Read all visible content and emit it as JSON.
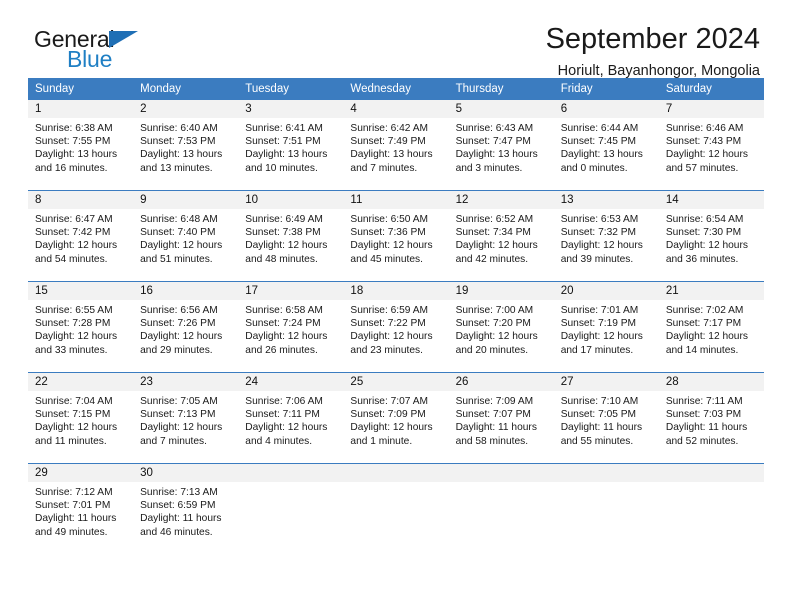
{
  "brand": {
    "word1": "General",
    "word2": "Blue",
    "logo_icon": "triangle-icon",
    "accent_color": "#1f6fb5"
  },
  "header": {
    "title": "September 2024",
    "subtitle": "Horiult, Bayanhongor, Mongolia",
    "header_bg_color": "#3b7cc0",
    "day_band_color": "#f2f2f2"
  },
  "weekday_headers": [
    "Sunday",
    "Monday",
    "Tuesday",
    "Wednesday",
    "Thursday",
    "Friday",
    "Saturday"
  ],
  "weeks": [
    [
      {
        "day": "1",
        "sunrise": "Sunrise: 6:38 AM",
        "sunset": "Sunset: 7:55 PM",
        "daylight1": "Daylight: 13 hours",
        "daylight2": "and 16 minutes."
      },
      {
        "day": "2",
        "sunrise": "Sunrise: 6:40 AM",
        "sunset": "Sunset: 7:53 PM",
        "daylight1": "Daylight: 13 hours",
        "daylight2": "and 13 minutes."
      },
      {
        "day": "3",
        "sunrise": "Sunrise: 6:41 AM",
        "sunset": "Sunset: 7:51 PM",
        "daylight1": "Daylight: 13 hours",
        "daylight2": "and 10 minutes."
      },
      {
        "day": "4",
        "sunrise": "Sunrise: 6:42 AM",
        "sunset": "Sunset: 7:49 PM",
        "daylight1": "Daylight: 13 hours",
        "daylight2": "and 7 minutes."
      },
      {
        "day": "5",
        "sunrise": "Sunrise: 6:43 AM",
        "sunset": "Sunset: 7:47 PM",
        "daylight1": "Daylight: 13 hours",
        "daylight2": "and 3 minutes."
      },
      {
        "day": "6",
        "sunrise": "Sunrise: 6:44 AM",
        "sunset": "Sunset: 7:45 PM",
        "daylight1": "Daylight: 13 hours",
        "daylight2": "and 0 minutes."
      },
      {
        "day": "7",
        "sunrise": "Sunrise: 6:46 AM",
        "sunset": "Sunset: 7:43 PM",
        "daylight1": "Daylight: 12 hours",
        "daylight2": "and 57 minutes."
      }
    ],
    [
      {
        "day": "8",
        "sunrise": "Sunrise: 6:47 AM",
        "sunset": "Sunset: 7:42 PM",
        "daylight1": "Daylight: 12 hours",
        "daylight2": "and 54 minutes."
      },
      {
        "day": "9",
        "sunrise": "Sunrise: 6:48 AM",
        "sunset": "Sunset: 7:40 PM",
        "daylight1": "Daylight: 12 hours",
        "daylight2": "and 51 minutes."
      },
      {
        "day": "10",
        "sunrise": "Sunrise: 6:49 AM",
        "sunset": "Sunset: 7:38 PM",
        "daylight1": "Daylight: 12 hours",
        "daylight2": "and 48 minutes."
      },
      {
        "day": "11",
        "sunrise": "Sunrise: 6:50 AM",
        "sunset": "Sunset: 7:36 PM",
        "daylight1": "Daylight: 12 hours",
        "daylight2": "and 45 minutes."
      },
      {
        "day": "12",
        "sunrise": "Sunrise: 6:52 AM",
        "sunset": "Sunset: 7:34 PM",
        "daylight1": "Daylight: 12 hours",
        "daylight2": "and 42 minutes."
      },
      {
        "day": "13",
        "sunrise": "Sunrise: 6:53 AM",
        "sunset": "Sunset: 7:32 PM",
        "daylight1": "Daylight: 12 hours",
        "daylight2": "and 39 minutes."
      },
      {
        "day": "14",
        "sunrise": "Sunrise: 6:54 AM",
        "sunset": "Sunset: 7:30 PM",
        "daylight1": "Daylight: 12 hours",
        "daylight2": "and 36 minutes."
      }
    ],
    [
      {
        "day": "15",
        "sunrise": "Sunrise: 6:55 AM",
        "sunset": "Sunset: 7:28 PM",
        "daylight1": "Daylight: 12 hours",
        "daylight2": "and 33 minutes."
      },
      {
        "day": "16",
        "sunrise": "Sunrise: 6:56 AM",
        "sunset": "Sunset: 7:26 PM",
        "daylight1": "Daylight: 12 hours",
        "daylight2": "and 29 minutes."
      },
      {
        "day": "17",
        "sunrise": "Sunrise: 6:58 AM",
        "sunset": "Sunset: 7:24 PM",
        "daylight1": "Daylight: 12 hours",
        "daylight2": "and 26 minutes."
      },
      {
        "day": "18",
        "sunrise": "Sunrise: 6:59 AM",
        "sunset": "Sunset: 7:22 PM",
        "daylight1": "Daylight: 12 hours",
        "daylight2": "and 23 minutes."
      },
      {
        "day": "19",
        "sunrise": "Sunrise: 7:00 AM",
        "sunset": "Sunset: 7:20 PM",
        "daylight1": "Daylight: 12 hours",
        "daylight2": "and 20 minutes."
      },
      {
        "day": "20",
        "sunrise": "Sunrise: 7:01 AM",
        "sunset": "Sunset: 7:19 PM",
        "daylight1": "Daylight: 12 hours",
        "daylight2": "and 17 minutes."
      },
      {
        "day": "21",
        "sunrise": "Sunrise: 7:02 AM",
        "sunset": "Sunset: 7:17 PM",
        "daylight1": "Daylight: 12 hours",
        "daylight2": "and 14 minutes."
      }
    ],
    [
      {
        "day": "22",
        "sunrise": "Sunrise: 7:04 AM",
        "sunset": "Sunset: 7:15 PM",
        "daylight1": "Daylight: 12 hours",
        "daylight2": "and 11 minutes."
      },
      {
        "day": "23",
        "sunrise": "Sunrise: 7:05 AM",
        "sunset": "Sunset: 7:13 PM",
        "daylight1": "Daylight: 12 hours",
        "daylight2": "and 7 minutes."
      },
      {
        "day": "24",
        "sunrise": "Sunrise: 7:06 AM",
        "sunset": "Sunset: 7:11 PM",
        "daylight1": "Daylight: 12 hours",
        "daylight2": "and 4 minutes."
      },
      {
        "day": "25",
        "sunrise": "Sunrise: 7:07 AM",
        "sunset": "Sunset: 7:09 PM",
        "daylight1": "Daylight: 12 hours",
        "daylight2": "and 1 minute."
      },
      {
        "day": "26",
        "sunrise": "Sunrise: 7:09 AM",
        "sunset": "Sunset: 7:07 PM",
        "daylight1": "Daylight: 11 hours",
        "daylight2": "and 58 minutes."
      },
      {
        "day": "27",
        "sunrise": "Sunrise: 7:10 AM",
        "sunset": "Sunset: 7:05 PM",
        "daylight1": "Daylight: 11 hours",
        "daylight2": "and 55 minutes."
      },
      {
        "day": "28",
        "sunrise": "Sunrise: 7:11 AM",
        "sunset": "Sunset: 7:03 PM",
        "daylight1": "Daylight: 11 hours",
        "daylight2": "and 52 minutes."
      }
    ],
    [
      {
        "day": "29",
        "sunrise": "Sunrise: 7:12 AM",
        "sunset": "Sunset: 7:01 PM",
        "daylight1": "Daylight: 11 hours",
        "daylight2": "and 49 minutes."
      },
      {
        "day": "30",
        "sunrise": "Sunrise: 7:13 AM",
        "sunset": "Sunset: 6:59 PM",
        "daylight1": "Daylight: 11 hours",
        "daylight2": "and 46 minutes."
      },
      {
        "day": "",
        "sunrise": "",
        "sunset": "",
        "daylight1": "",
        "daylight2": ""
      },
      {
        "day": "",
        "sunrise": "",
        "sunset": "",
        "daylight1": "",
        "daylight2": ""
      },
      {
        "day": "",
        "sunrise": "",
        "sunset": "",
        "daylight1": "",
        "daylight2": ""
      },
      {
        "day": "",
        "sunrise": "",
        "sunset": "",
        "daylight1": "",
        "daylight2": ""
      },
      {
        "day": "",
        "sunrise": "",
        "sunset": "",
        "daylight1": "",
        "daylight2": ""
      }
    ]
  ]
}
